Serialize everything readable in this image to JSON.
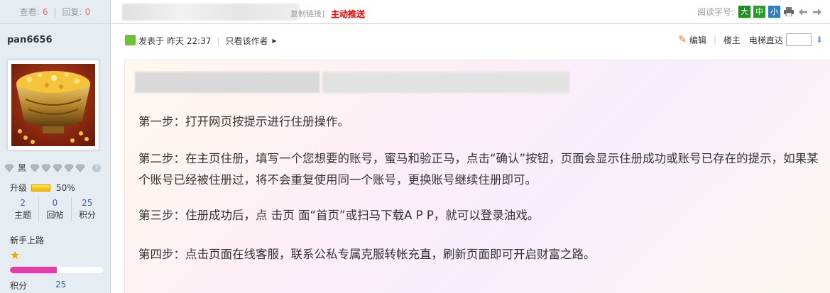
{
  "topstats": {
    "views_label": "查看:",
    "views": "6",
    "replies_label": "回复:",
    "replies": "0"
  },
  "user": {
    "name": "pan6656",
    "rank_text": "黑",
    "upgrade_label": "升级",
    "upgrade_percent": "50%",
    "upgrade_progress": 0.5,
    "counts": [
      {
        "value": "2",
        "label": "主题"
      },
      {
        "value": "0",
        "label": "回帖"
      },
      {
        "value": "25",
        "label": "积分"
      }
    ],
    "group_title": "新手上路",
    "progress": 0.5,
    "points_label": "积分",
    "points_value": "25"
  },
  "topbar": {
    "copy_link": "复制链接]",
    "push": "主动推送",
    "font_label": "阅读字号:",
    "font_large": "大",
    "font_medium": "中",
    "font_small": "小"
  },
  "post": {
    "posted_label": "发表于",
    "posted_time": "昨天 22:37",
    "author_only": "只看该作者",
    "edit": "编辑",
    "floor": "楼主",
    "elevator": "电梯直达",
    "paragraphs": [
      "第一步：打开网页按提示进行住册操作。",
      "第二步：在主页住册，填写一个您想要的账号，蜜马和验正马，点击“确认”按钮，页面会显示住册成功或账号已存在的提示，如果某个账号已经被住册过，将不会重复使用同一个账号，更换账号继续住册即可。",
      "第三步：住册成功后，点 击页 面“首页”或扫马下载A P P，就可以登录油戏。",
      "第四步：点击页面在线客服，联系公私专属克服转帐充直，刷新页面即可开启财富之路。"
    ]
  },
  "icons": {
    "print": "print-icon",
    "prev": "prev-arrow-icon",
    "next": "next-arrow-icon",
    "edit": "pencil-icon",
    "down": "down-arrow-icon"
  },
  "colors": {
    "push_red": "#ee0000",
    "number_red": "#f26c4f",
    "link_blue": "#336699",
    "progress_pink": "#e23fa6"
  }
}
